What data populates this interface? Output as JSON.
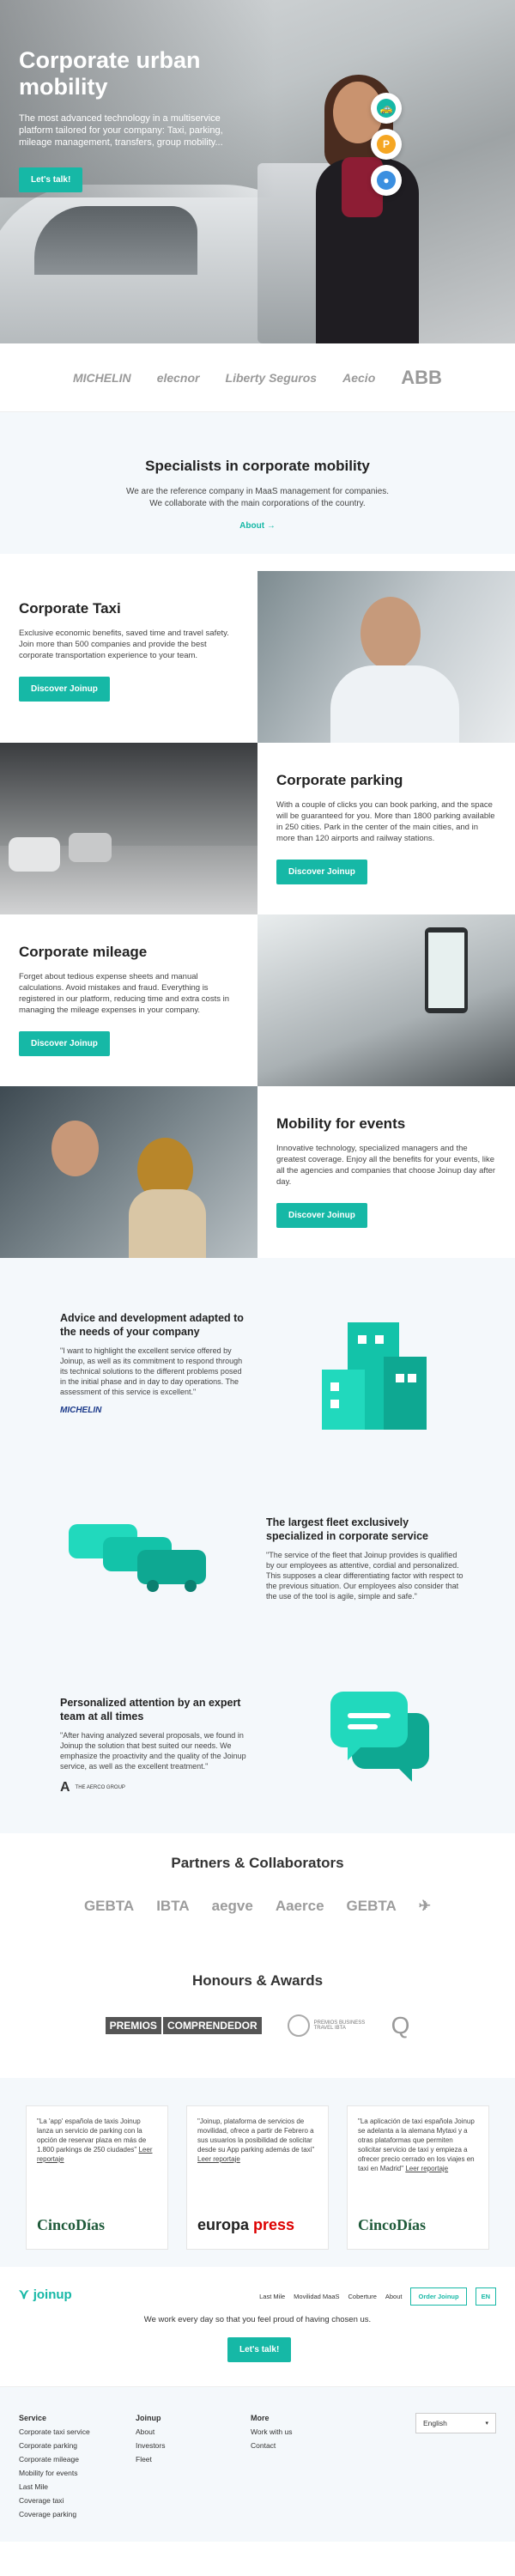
{
  "hero": {
    "title": "Corporate urban mobility",
    "subtitle": "The most advanced technology in a multiservice platform tailored for your company: Taxi, parking, mileage management, transfers, group mobility...",
    "cta": "Let's talk!"
  },
  "clients": [
    "MICHELIN",
    "elecnor",
    "Liberty Seguros",
    "Aecio",
    "ABB"
  ],
  "specialists": {
    "title": "Specialists in corporate mobility",
    "text": "We are the reference company in MaaS management for companies. We collaborate with the main corporations of the country.",
    "link": "About"
  },
  "services": [
    {
      "title": "Corporate Taxi",
      "text": "Exclusive economic benefits, saved time and travel safety. Join more than 500 companies and provide the best corporate transportation experience to your team.",
      "cta": "Discover Joinup"
    },
    {
      "title": "Corporate parking",
      "text": "With a couple of clicks you can book parking, and the space will be guaranteed for you. More than 1800 parking available in 250 cities. Park in the center of the main cities, and in more than 120 airports and railway stations.",
      "cta": "Discover Joinup"
    },
    {
      "title": "Corporate mileage",
      "text": "Forget about tedious expense sheets and manual calculations. Avoid mistakes and fraud. Everything is registered in our platform, reducing time and extra costs in managing the mileage expenses in your company.",
      "cta": "Discover Joinup"
    },
    {
      "title": "Mobility for events",
      "text": "Innovative technology, specialized managers and the greatest coverage. Enjoy all the benefits for your events, like all the agencies and companies that choose Joinup day after day.",
      "cta": "Discover Joinup"
    }
  ],
  "testimonials": [
    {
      "title": "Advice and development adapted to the needs of your company",
      "quote": "\"I want to highlight the excellent service offered by Joinup, as well as its commitment to respond through its technical solutions to the different problems posed in the initial phase and in day to day operations. The assessment of this service is excellent.\"",
      "logo": "MICHELIN"
    },
    {
      "title": "The largest fleet exclusively specialized in corporate service",
      "quote": "\"The service of the fleet that Joinup provides is qualified by our employees as attentive, cordial and personalized. This supposes a clear differentiating factor with respect to the previous situation. Our employees also consider that the use of the tool is agile, simple and safe.\""
    },
    {
      "title": "Personalized attention by an expert team at all times",
      "quote": "\"After having analyzed several proposals, we found in Joinup the solution that best suited our needs. We emphasize the proactivity and the quality of the Joinup service, as well as the excellent treatment.\"",
      "logo": "THE AERCO GROUP"
    }
  ],
  "partners": {
    "title": "Partners & Collaborators",
    "logos": [
      "GEBTA",
      "IBTA",
      "aegve",
      "Aaerce",
      "GEBTA",
      "✈"
    ]
  },
  "honours": {
    "title": "Honours & Awards",
    "logos": [
      "PREMIOS",
      "COMPRENDEDOR",
      "PREMIOS BUSINESS TRAVEL IBTA",
      "Q"
    ]
  },
  "press": [
    {
      "quote": "\"La 'app' española de taxis Joinup lanza un servicio de parking con la opción de reservar plaza en más de 1.800 parkings de 250 ciudades\" ",
      "link": "Leer reportaje",
      "logo": "CincoDías"
    },
    {
      "quote": "\"Joinup, plataforma de servicios de movilidad, ofrece a partir de Febrero a sus usuarios la posibilidad de solicitar desde su App parking además de taxi\" ",
      "link": "Leer reportaje",
      "logo_a": "europa ",
      "logo_b": "press"
    },
    {
      "quote": "\"La aplicación de taxi española Joinup se adelanta a la alemana Mytaxi y a otras plataformas que permiten solicitar servicio de taxi y empieza a ofrecer precio cerrado en los viajes en taxi en Madrid\" ",
      "link": "Leer reportaje",
      "logo": "CincoDías"
    }
  ],
  "footer": {
    "brand": "joinup",
    "nav": [
      "Last Mile",
      "Movilidad MaaS",
      "Coberture",
      "About"
    ],
    "order": "Order Joinup",
    "lang": "EN",
    "slogan": "We work every day so that you feel proud of having chosen us.",
    "cta": "Let's talk!",
    "columns": [
      {
        "title": "Service",
        "items": [
          "Corporate taxi service",
          "Corporate parking",
          "Corporate mileage",
          "Mobility for events",
          "Last Mile",
          "Coverage taxi",
          "Coverage parking"
        ]
      },
      {
        "title": "Joinup",
        "items": [
          "About",
          "Investors",
          "Fleet"
        ]
      },
      {
        "title": "More",
        "items": [
          "Work with us",
          "Contact"
        ]
      }
    ],
    "language": "English"
  },
  "colors": {
    "accent": "#16b8a6",
    "background_alt": "#f4f8fb"
  }
}
